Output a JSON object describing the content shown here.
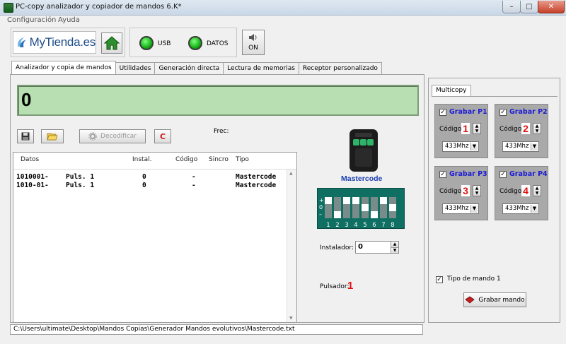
{
  "window": {
    "title": "PC-copy analizador y copiador de mandos 6.K*",
    "minimize": "–",
    "maximize": "□",
    "close": "✕"
  },
  "menu": [
    "Configuración",
    "Ayuda"
  ],
  "logo": {
    "text": "MyTienda.es"
  },
  "indicators": {
    "usb_label": "USB",
    "datos_label": "DATOS"
  },
  "sound": {
    "label": "ON",
    "icon": "speaker-icon"
  },
  "tabs": [
    "Analizador y copia de mandos",
    "Utilidades",
    "Generación directa",
    "Lectura de memorias",
    "Receptor personalizado"
  ],
  "display": {
    "value": "0"
  },
  "toolbar": {
    "decode_label": "Decodificar",
    "clear_label": "C",
    "frec_label": "Frec:"
  },
  "table": {
    "columns": [
      "Datos",
      "Instal.",
      "Código",
      "Sincro",
      "Tipo"
    ],
    "rows": [
      {
        "datos": "1010001-",
        "puls": "Puls. 1",
        "instal": "0",
        "codigo": "-",
        "tipo": "Mastercode"
      },
      {
        "datos": "1010-01-",
        "puls": "Puls. 1",
        "instal": "0",
        "codigo": "-",
        "tipo": "Mastercode"
      }
    ]
  },
  "status": {
    "path": "C:\\Users\\ultimate\\Desktop\\Mandos Copias\\Generador Mandos evolutivos\\Mastercode.txt"
  },
  "remote": {
    "name": "Mastercode",
    "dip_labels": [
      "+",
      "0",
      "–"
    ],
    "dip_numbers": [
      "1",
      "2",
      "3",
      "4",
      "5",
      "6",
      "7",
      "8"
    ]
  },
  "instalador": {
    "label": "Instalador:",
    "value": "0"
  },
  "pulsador": {
    "label": "Pulsador:",
    "value": "1"
  },
  "multicopy": {
    "tab_label": "Multicopy",
    "groups": [
      {
        "title": "Grabar P1",
        "codigo_label": "Código:",
        "codigo": "1",
        "freq": "433Mhz"
      },
      {
        "title": "Grabar P2",
        "codigo_label": "Código:",
        "codigo": "2",
        "freq": "433Mhz"
      },
      {
        "title": "Grabar P3",
        "codigo_label": "Código:",
        "codigo": "3",
        "freq": "433Mhz"
      },
      {
        "title": "Grabar P4",
        "codigo_label": "Código:",
        "codigo": "4",
        "freq": "433Mhz"
      }
    ],
    "tipo_label": "Tipo de mando 1",
    "grabar_label": "Grabar mando"
  },
  "colors": {
    "display_bg": "#b7dfb2",
    "dip_bg": "#0f6f63",
    "accent_red": "#e01010",
    "group_title": "#1b1bd4",
    "led_green": "#16b116"
  }
}
